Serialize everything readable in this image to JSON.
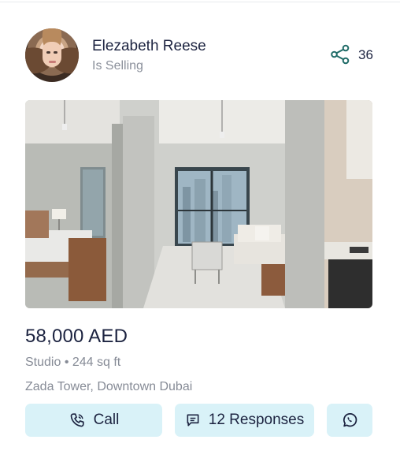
{
  "seller": {
    "name": "Elezabeth Reese",
    "status": "Is Selling"
  },
  "share": {
    "icon": "share-icon",
    "count": "36"
  },
  "listing": {
    "price": "58,000 AED",
    "meta": "Studio • 244 sq ft",
    "location": "Zada Tower, Downtown Dubai"
  },
  "actions": {
    "call_label": "Call",
    "call_icon": "phone-icon",
    "responses_label": "12 Responses",
    "responses_icon": "message-icon",
    "whatsapp_icon": "whatsapp-icon"
  },
  "colors": {
    "button_bg": "#d9f2f8",
    "text_primary": "#1c2340",
    "text_muted": "#868b96",
    "share_icon": "#1f6b67"
  }
}
